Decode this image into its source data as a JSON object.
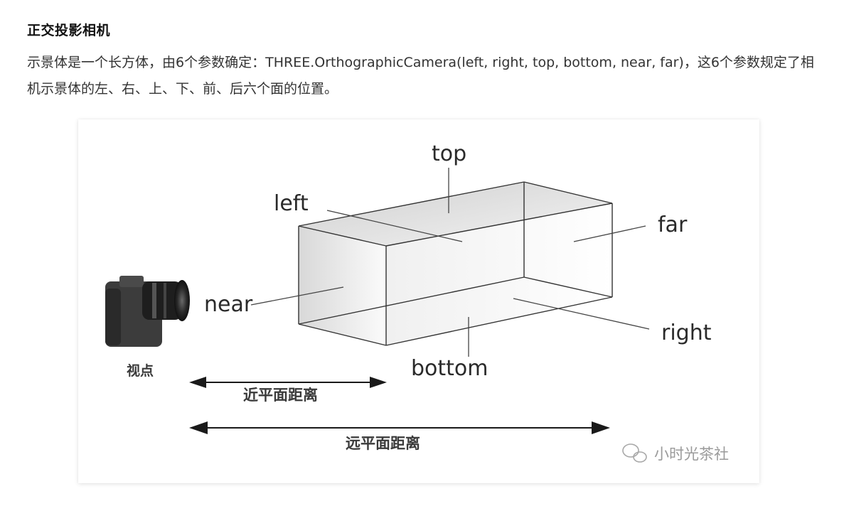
{
  "article": {
    "heading": "正交投影相机",
    "paragraph": "示景体是一个长方体，由6个参数确定：THREE.OrthographicCamera(left, right, top, bottom, near, far)，这6个参数规定了相机示景体的左、右、上、下、前、后六个面的位置。"
  },
  "diagram": {
    "labels": {
      "top": "top",
      "left": "left",
      "far": "far",
      "near": "near",
      "right": "right",
      "bottom": "bottom",
      "viewpoint": "视点",
      "near_distance": "近平面距离",
      "far_distance": "远平面距离"
    },
    "watermark": "小时光茶社",
    "icons": [
      "camera-icon",
      "wechat-icon"
    ]
  }
}
